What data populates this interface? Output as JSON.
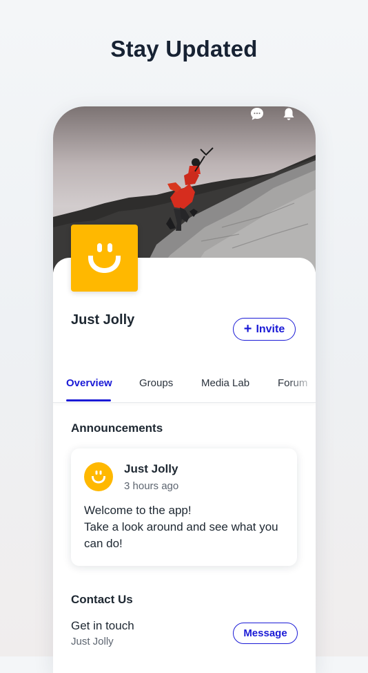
{
  "headline": "Stay Updated",
  "profile": {
    "name": "Just Jolly",
    "invite_label": "Invite"
  },
  "tabs": [
    {
      "label": "Overview",
      "active": true
    },
    {
      "label": "Groups",
      "active": false
    },
    {
      "label": "Media Lab",
      "active": false
    },
    {
      "label": "Forum",
      "active": false
    }
  ],
  "announcements": {
    "title": "Announcements",
    "post": {
      "author": "Just Jolly",
      "time": "3 hours ago",
      "body_line1": "Welcome to the app!",
      "body_line2": "Take a look around and see what you can do!"
    }
  },
  "contact": {
    "title": "Contact Us",
    "label": "Get in touch",
    "sub": "Just Jolly",
    "message_label": "Message"
  },
  "icons": {
    "chat": "chat-bubble-icon",
    "notifications": "bell-icon",
    "invite": "plus-icon"
  },
  "colors": {
    "accent": "#1a1ad6",
    "brand_yellow": "#ffb800",
    "headline": "#172233"
  }
}
